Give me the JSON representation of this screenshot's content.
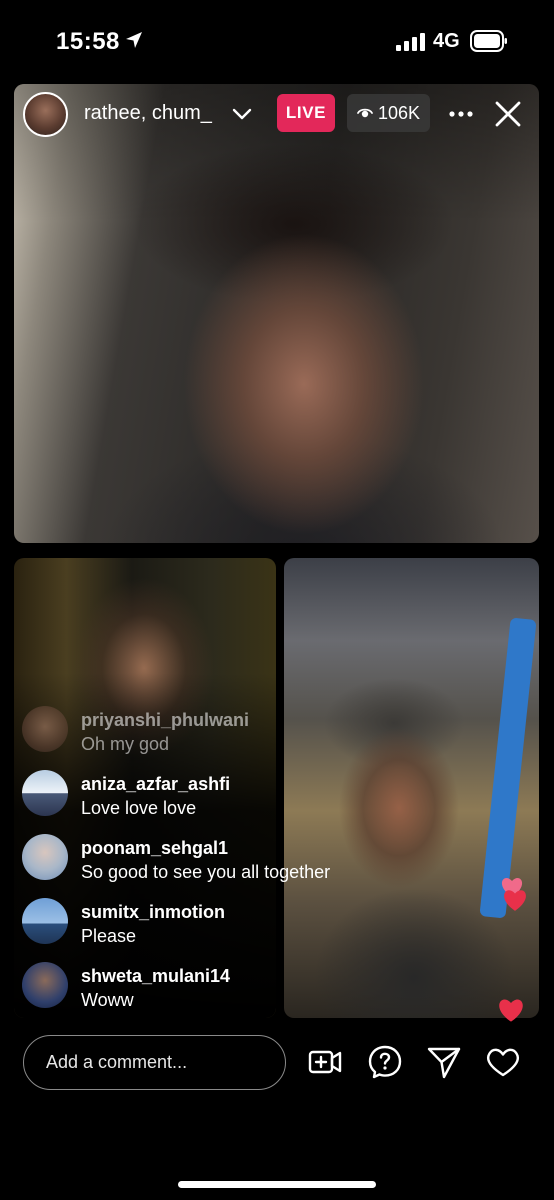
{
  "status_bar": {
    "time": "15:58",
    "network": "4G",
    "icons": [
      "location-arrow-icon",
      "signal-bars-icon",
      "battery-icon"
    ]
  },
  "live_header": {
    "host_names": "rathee, chum_",
    "live_label": "LIVE",
    "viewer_count": "106K",
    "live_color": "#e3285a",
    "icons": [
      "chevron-down-icon",
      "eye-icon",
      "more-icon",
      "close-icon"
    ]
  },
  "comments": [
    {
      "username": "priyanshi_phulwani",
      "text": "Oh my god"
    },
    {
      "username": "aniza_azfar_ashfi",
      "text": "Love love love"
    },
    {
      "username": "poonam_sehgal1",
      "text": "So good to see you all together"
    },
    {
      "username": "sumitx_inmotion",
      "text": "Please"
    },
    {
      "username": "shweta_mulani14",
      "text": "Woww"
    }
  ],
  "bottom_bar": {
    "comment_placeholder": "Add a comment...",
    "icons": [
      "add-video-icon",
      "question-icon",
      "send-icon",
      "heart-icon"
    ]
  },
  "colors": {
    "heart": "#e8304a",
    "heart_light": "#f06a8a"
  }
}
